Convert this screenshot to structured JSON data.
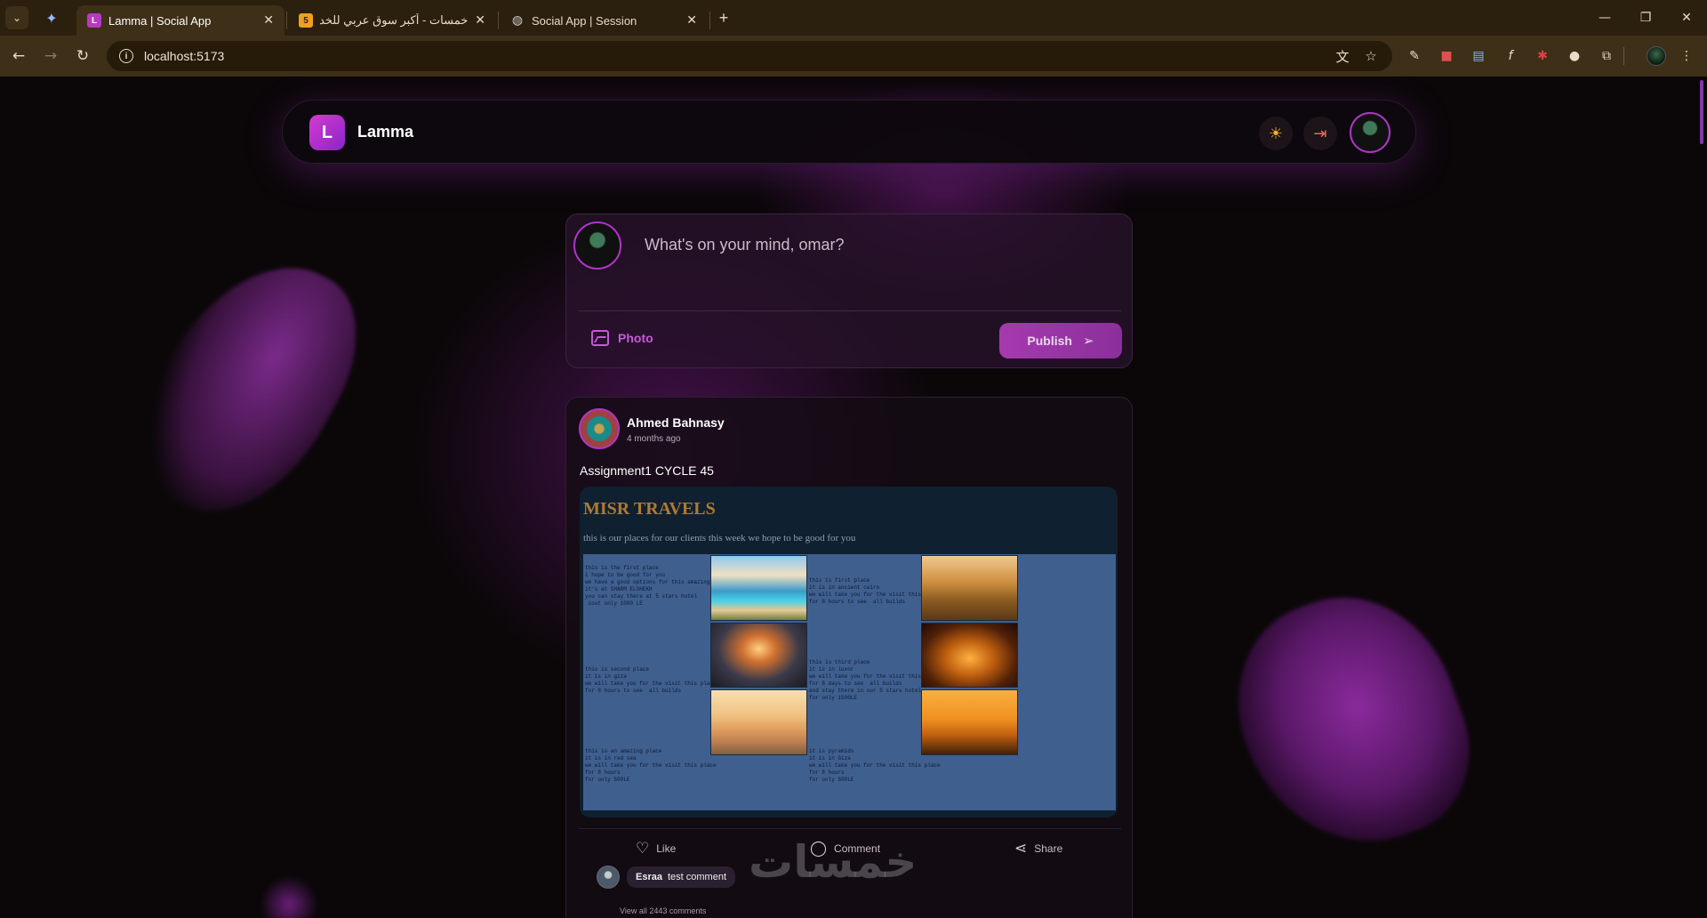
{
  "browser": {
    "tabs": [
      {
        "title": "Lamma | Social App",
        "favicon": "L",
        "favicon_color": "#b83ac4",
        "active": true
      },
      {
        "title": "خمسات - أكبر سوق عربي للخدمات",
        "favicon": "5",
        "favicon_color": "#f0a020",
        "active": false
      },
      {
        "title": "Social App | Session",
        "favicon": "globe-icon",
        "favicon_color": "#cccccc",
        "active": false
      }
    ],
    "new_tab_label": "+",
    "url": "localhost:5173"
  },
  "app": {
    "logo_letter": "L",
    "name": "Lamma",
    "accent": "#b035c8"
  },
  "composer": {
    "placeholder": "What's on your mind, omar?",
    "photo_label": "Photo",
    "publish_label": "Publish"
  },
  "post": {
    "author": "Ahmed Bahnasy",
    "time": "4 months ago",
    "text": "Assignment1 CYCLE 45",
    "image": {
      "title": "MISR TRAVELS",
      "subtitle": "this is our places for our clients this week we hope to be good for you",
      "cells": [
        "this is the first place\ni hope to be good for you\nwe have a good options for this amazing places\nit's at SHARM ELSHEKH\nyou can stay there at 5 stars hotel\n cost only 1000 LE",
        "this is first place\nit is in ancient cairo\nwe will take you for the visit this place\nfor 8 hours to see  all builds",
        "this is second place\nit is in giza\nwe will take you for the visit this place\nfor 8 hours to see  all builds",
        "this is third place\nit is in luxor\nwe will take you for the visit this place\nfor 8 days to see  all builds\nand stay there in our 5 stars hotel\nfor only 1500LE",
        "this is an amazing place\nit is in red sea\nwe will take you for the visit this place\nfor 8 hours\nfor only 500LE",
        "it is pyramids\nit is in Giza\nwe will take you for the visit this place\nfor 8 hours\nfor only 500LE"
      ]
    },
    "actions": {
      "like": "Like",
      "comment": "Comment",
      "share": "Share"
    },
    "comment": {
      "author": "Esraa",
      "text": "test comment"
    },
    "view_all": "View all 2443 comments"
  },
  "watermark": "خمسات"
}
